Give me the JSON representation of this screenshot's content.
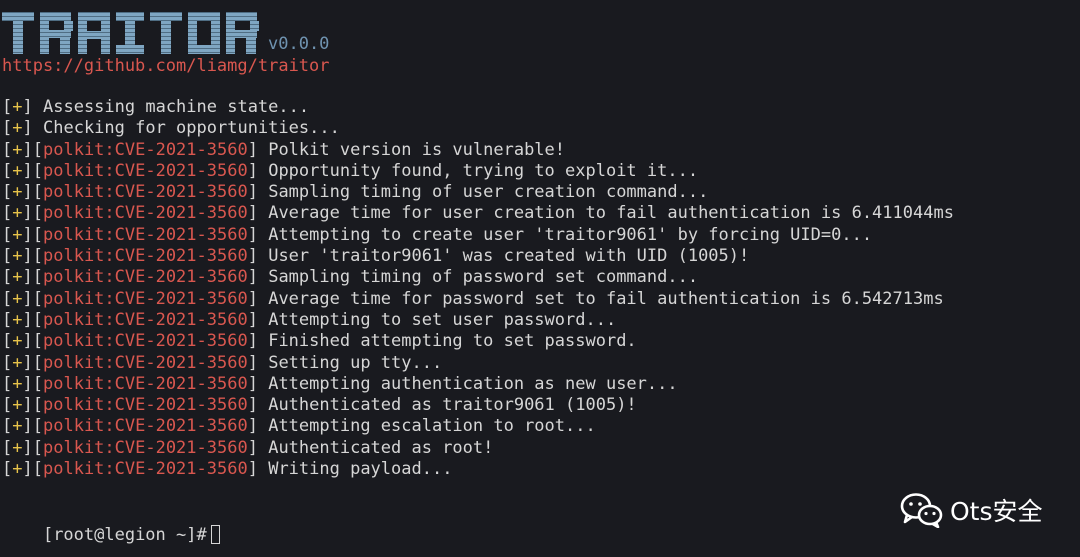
{
  "banner": {
    "logo_text": "TRAITOR",
    "version": "v0.0.0",
    "repo_url": "https://github.com/liamg/traitor"
  },
  "log": [
    {
      "marker": "+",
      "tag": "",
      "message": "Assessing machine state..."
    },
    {
      "marker": "+",
      "tag": "",
      "message": "Checking for opportunities..."
    },
    {
      "marker": "+",
      "tag": "polkit:CVE-2021-3560",
      "message": "Polkit version is vulnerable!"
    },
    {
      "marker": "+",
      "tag": "polkit:CVE-2021-3560",
      "message": "Opportunity found, trying to exploit it..."
    },
    {
      "marker": "+",
      "tag": "polkit:CVE-2021-3560",
      "message": "Sampling timing of user creation command..."
    },
    {
      "marker": "+",
      "tag": "polkit:CVE-2021-3560",
      "message": "Average time for user creation to fail authentication is 6.411044ms"
    },
    {
      "marker": "+",
      "tag": "polkit:CVE-2021-3560",
      "message": "Attempting to create user 'traitor9061' by forcing UID=0..."
    },
    {
      "marker": "+",
      "tag": "polkit:CVE-2021-3560",
      "message": "User 'traitor9061' was created with UID (1005)!"
    },
    {
      "marker": "+",
      "tag": "polkit:CVE-2021-3560",
      "message": "Sampling timing of password set command..."
    },
    {
      "marker": "+",
      "tag": "polkit:CVE-2021-3560",
      "message": "Average time for password set to fail authentication is 6.542713ms"
    },
    {
      "marker": "+",
      "tag": "polkit:CVE-2021-3560",
      "message": "Attempting to set user password..."
    },
    {
      "marker": "+",
      "tag": "polkit:CVE-2021-3560",
      "message": "Finished attempting to set password."
    },
    {
      "marker": "+",
      "tag": "polkit:CVE-2021-3560",
      "message": "Setting up tty..."
    },
    {
      "marker": "+",
      "tag": "polkit:CVE-2021-3560",
      "message": "Attempting authentication as new user..."
    },
    {
      "marker": "+",
      "tag": "polkit:CVE-2021-3560",
      "message": "Authenticated as traitor9061 (1005)!"
    },
    {
      "marker": "+",
      "tag": "polkit:CVE-2021-3560",
      "message": "Attempting escalation to root..."
    },
    {
      "marker": "+",
      "tag": "polkit:CVE-2021-3560",
      "message": "Authenticated as root!"
    },
    {
      "marker": "+",
      "tag": "polkit:CVE-2021-3560",
      "message": "Writing payload..."
    }
  ],
  "prompt": {
    "text": "[root@legion ~]#"
  },
  "watermark": {
    "icon": "wechat-icon",
    "text": "Ots安全"
  },
  "colors": {
    "background": "#191a1f",
    "text": "#d6d6d6",
    "plus": "#e7c34a",
    "tag": "#d9574f",
    "logo": "#7fa6c2",
    "version": "#6f93b0"
  }
}
